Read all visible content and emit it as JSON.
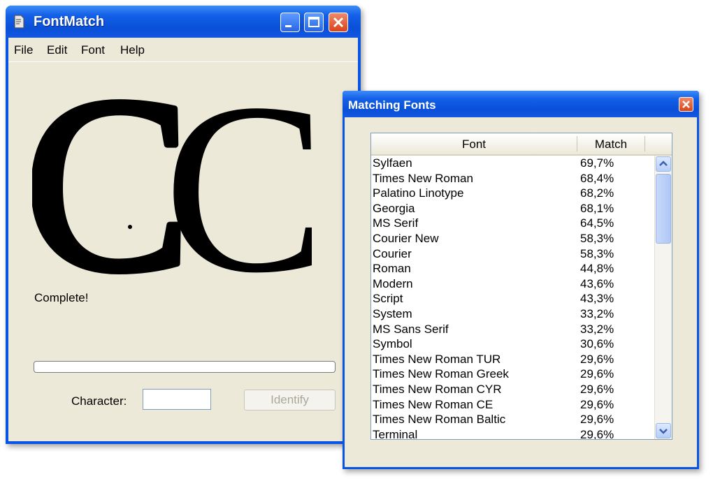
{
  "main_window": {
    "title": "FontMatch",
    "menu": [
      "File",
      "Edit",
      "Font",
      "Help"
    ],
    "status": "Complete!",
    "progress": 0,
    "character_label": "Character:",
    "character_value": "",
    "identify_label": "Identify",
    "glyph_text": "C",
    "icons": [
      "app-icon",
      "minimize-icon",
      "maximize-icon",
      "close-icon"
    ]
  },
  "dialog": {
    "title": "Matching Fonts",
    "columns": [
      "Font",
      "Match"
    ],
    "rows": [
      {
        "font": "Sylfaen",
        "match": "69,7%"
      },
      {
        "font": "Times New Roman",
        "match": "68,4%"
      },
      {
        "font": "Palatino Linotype",
        "match": "68,2%"
      },
      {
        "font": "Georgia",
        "match": "68,1%"
      },
      {
        "font": "MS Serif",
        "match": "64,5%"
      },
      {
        "font": "Courier New",
        "match": "58,3%"
      },
      {
        "font": "Courier",
        "match": "58,3%"
      },
      {
        "font": "Roman",
        "match": "44,8%"
      },
      {
        "font": "Modern",
        "match": "43,6%"
      },
      {
        "font": "Script",
        "match": "43,3%"
      },
      {
        "font": "System",
        "match": "33,2%"
      },
      {
        "font": "MS Sans Serif",
        "match": "33,2%"
      },
      {
        "font": "Symbol",
        "match": "30,6%"
      },
      {
        "font": "Times New Roman TUR",
        "match": "29,6%"
      },
      {
        "font": "Times New Roman Greek",
        "match": "29,6%"
      },
      {
        "font": "Times New Roman CYR",
        "match": "29,6%"
      },
      {
        "font": "Times New Roman CE",
        "match": "29,6%"
      },
      {
        "font": "Times New Roman Baltic",
        "match": "29,6%"
      },
      {
        "font": "Terminal",
        "match": "29,6%"
      }
    ],
    "icons": [
      "close-icon",
      "scroll-up-icon",
      "scroll-down-icon"
    ]
  },
  "colors": {
    "titlebar": "#0a54e4",
    "client": "#ece9d8",
    "close_button": "#d9431b"
  }
}
